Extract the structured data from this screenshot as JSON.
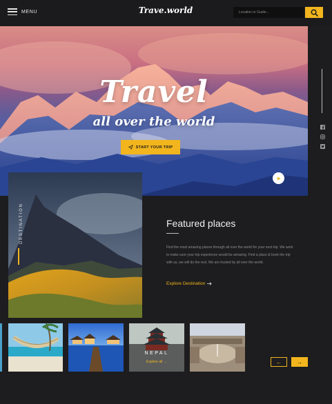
{
  "header": {
    "menu_label": "MENU",
    "logo": "Trave.world",
    "search_placeholder": "Location or Guide..."
  },
  "hero": {
    "title": "Travel",
    "subtitle": "all over the world",
    "cta_label": "START YOUR TRIP"
  },
  "destination": {
    "vertical_label": "DESTINATION"
  },
  "featured": {
    "title": "Featured places",
    "description": "Find the most amazing places through all over the world for your next trip. We work to make sure your trip experience would be amazing. Find a place & book the trip with us, we will do the rest. We are trusted by all over the world.",
    "link_label": "Explore Destination"
  },
  "places": [
    {
      "name": "",
      "icon": "beach-hammock"
    },
    {
      "name": "",
      "icon": "water-villas"
    },
    {
      "name": "NEPAL",
      "link_label": "Explore all",
      "icon": "temple"
    },
    {
      "name": "",
      "icon": "city-square"
    }
  ],
  "social_icons": [
    "facebook-icon",
    "instagram-icon",
    "twitter-icon"
  ],
  "colors": {
    "accent": "#f2b51d",
    "background": "#1d1d1f"
  },
  "nav": {
    "prev": "←",
    "next": "→"
  }
}
